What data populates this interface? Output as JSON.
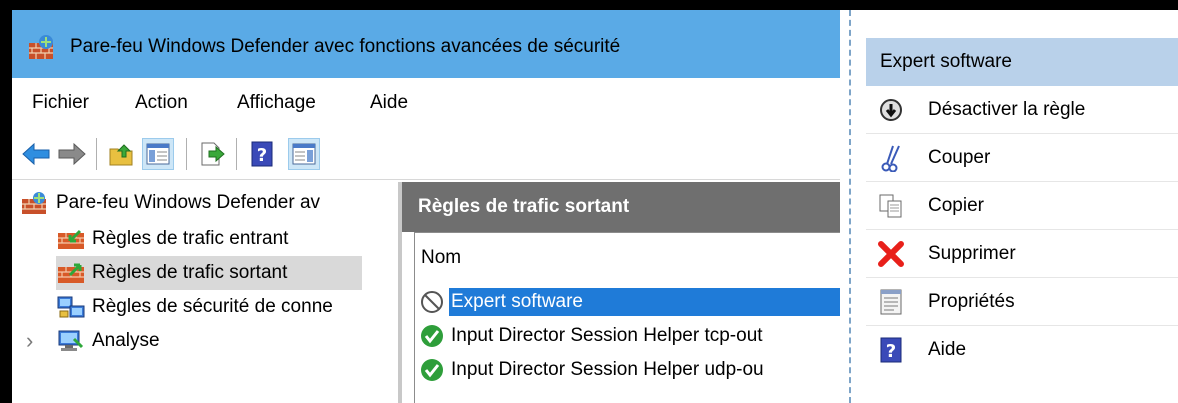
{
  "window": {
    "title": "Pare-feu Windows Defender avec fonctions avancées de sécurité"
  },
  "menu": {
    "items": [
      "Fichier",
      "Action",
      "Affichage",
      "Aide"
    ]
  },
  "toolbar": {
    "buttons": [
      "back-arrow-icon",
      "forward-arrow-icon",
      "up-folder-icon",
      "show-hide-console-tree-icon",
      "export-list-icon",
      "help-icon",
      "show-hide-action-pane-icon"
    ]
  },
  "tree": {
    "root": "Pare-feu Windows Defender av",
    "items": [
      {
        "label": "Règles de trafic entrant"
      },
      {
        "label": "Règles de trafic sortant",
        "selected": true
      },
      {
        "label": "Règles de sécurité de conne"
      },
      {
        "label": "Analyse",
        "expander": "›"
      }
    ]
  },
  "center": {
    "header": "Règles de trafic sortant",
    "column": "Nom",
    "rows": [
      {
        "name": "Expert software",
        "status": "disabled",
        "selected": true
      },
      {
        "name": "Input Director Session Helper tcp-out",
        "status": "enabled"
      },
      {
        "name": "Input Director Session Helper udp-ou",
        "status": "enabled"
      }
    ]
  },
  "actions": {
    "header": "Expert software",
    "items": [
      {
        "label": "Désactiver la règle",
        "icon": "disable-rule-icon"
      },
      {
        "label": "Couper",
        "icon": "scissors-icon"
      },
      {
        "label": "Copier",
        "icon": "copy-icon"
      },
      {
        "label": "Supprimer",
        "icon": "delete-x-icon"
      },
      {
        "label": "Propriétés",
        "icon": "properties-icon"
      },
      {
        "label": "Aide",
        "icon": "help-icon"
      }
    ]
  },
  "colors": {
    "titlebar": "#5aaae6",
    "selection": "#1f7bd8",
    "center_header": "#6f6f6f",
    "actions_header": "#b9d1ea",
    "delete_red": "#e8201a",
    "enabled_green": "#2e9e3a"
  }
}
